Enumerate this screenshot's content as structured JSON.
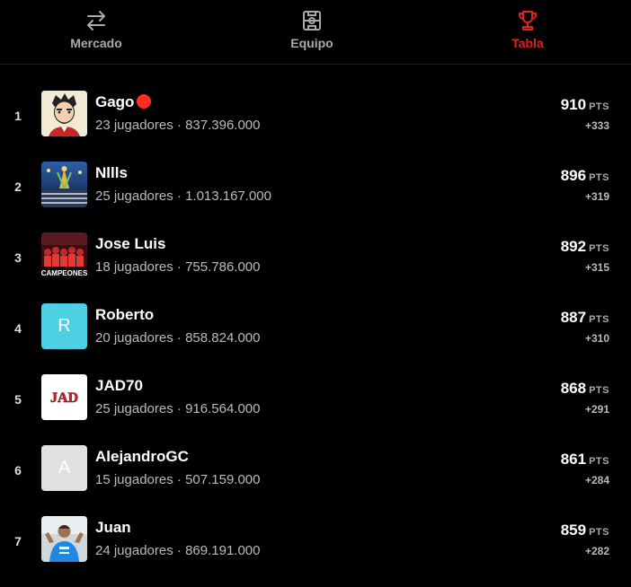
{
  "tabs": [
    {
      "label": "Mercado",
      "icon": "transfer-arrows-icon",
      "active": false
    },
    {
      "label": "Equipo",
      "icon": "pitch-icon",
      "active": true
    },
    {
      "label": "Tabla",
      "icon": "trophy-icon",
      "active": true
    }
  ],
  "colors": {
    "accent": "#e0231c",
    "live": "#ff2d22",
    "background": "#000000"
  },
  "standings": [
    {
      "rank": "1",
      "name": "Gago",
      "live": true,
      "sub": "23 jugadores · 837.396.000",
      "points": "910",
      "unit": "PTS",
      "diff": "+333",
      "avatar": "bearded-man-illustration"
    },
    {
      "rank": "2",
      "name": "Nllls",
      "live": false,
      "sub": "25 jugadores · 1.013.167.000",
      "points": "896",
      "unit": "PTS",
      "diff": "+319",
      "avatar": "stadium-trophy-photo"
    },
    {
      "rank": "3",
      "name": "Jose Luis",
      "live": false,
      "sub": "18 jugadores · 755.786.000",
      "points": "892",
      "unit": "PTS",
      "diff": "+315",
      "avatar": "campeones-team-photo",
      "avatar_text": "CAMPEONES"
    },
    {
      "rank": "4",
      "name": "Roberto",
      "live": false,
      "sub": "20 jugadores · 858.824.000",
      "points": "887",
      "unit": "PTS",
      "diff": "+310",
      "avatar_letter": "R",
      "avatar_color": "#4dd0e1"
    },
    {
      "rank": "5",
      "name": "JAD70",
      "live": false,
      "sub": "25 jugadores · 916.564.000",
      "points": "868",
      "unit": "PTS",
      "diff": "+291",
      "avatar": "jad-logo",
      "avatar_text": "JAD"
    },
    {
      "rank": "6",
      "name": "AlejandroGC",
      "live": false,
      "sub": "15 jugadores · 507.159.000",
      "points": "861",
      "unit": "PTS",
      "diff": "+284",
      "avatar_letter": "A",
      "avatar_color": "#e0e0e0"
    },
    {
      "rank": "7",
      "name": "Juan",
      "live": false,
      "sub": "24 jugadores · 869.191.000",
      "points": "859",
      "unit": "PTS",
      "diff": "+282",
      "avatar": "player-photo"
    }
  ]
}
